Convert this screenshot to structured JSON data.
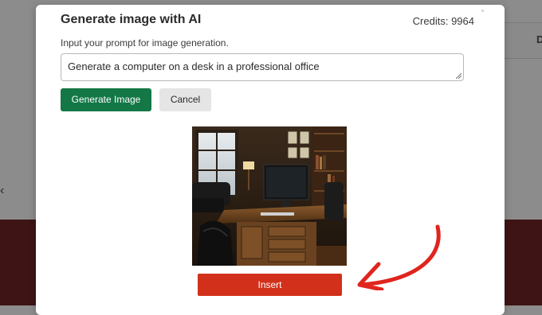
{
  "modal": {
    "title": "Generate image with AI",
    "credits_label": "Credits: 9964",
    "hint": "Input your prompt for image generation.",
    "prompt_value": "Generate a computer on a desk in a professional office",
    "generate_label": "Generate Image",
    "cancel_label": "Cancel",
    "insert_label": "Insert"
  },
  "background": {
    "right_tab_label": "D",
    "left_chevron": "‹"
  },
  "colors": {
    "generate": "#137746",
    "insert": "#d2301b",
    "arrow": "#e0251e",
    "backdrop_bottom": "#3e1414"
  },
  "icons": [
    "chevron-left-icon",
    "resize-grip-icon",
    "arrow-annotation-icon"
  ]
}
